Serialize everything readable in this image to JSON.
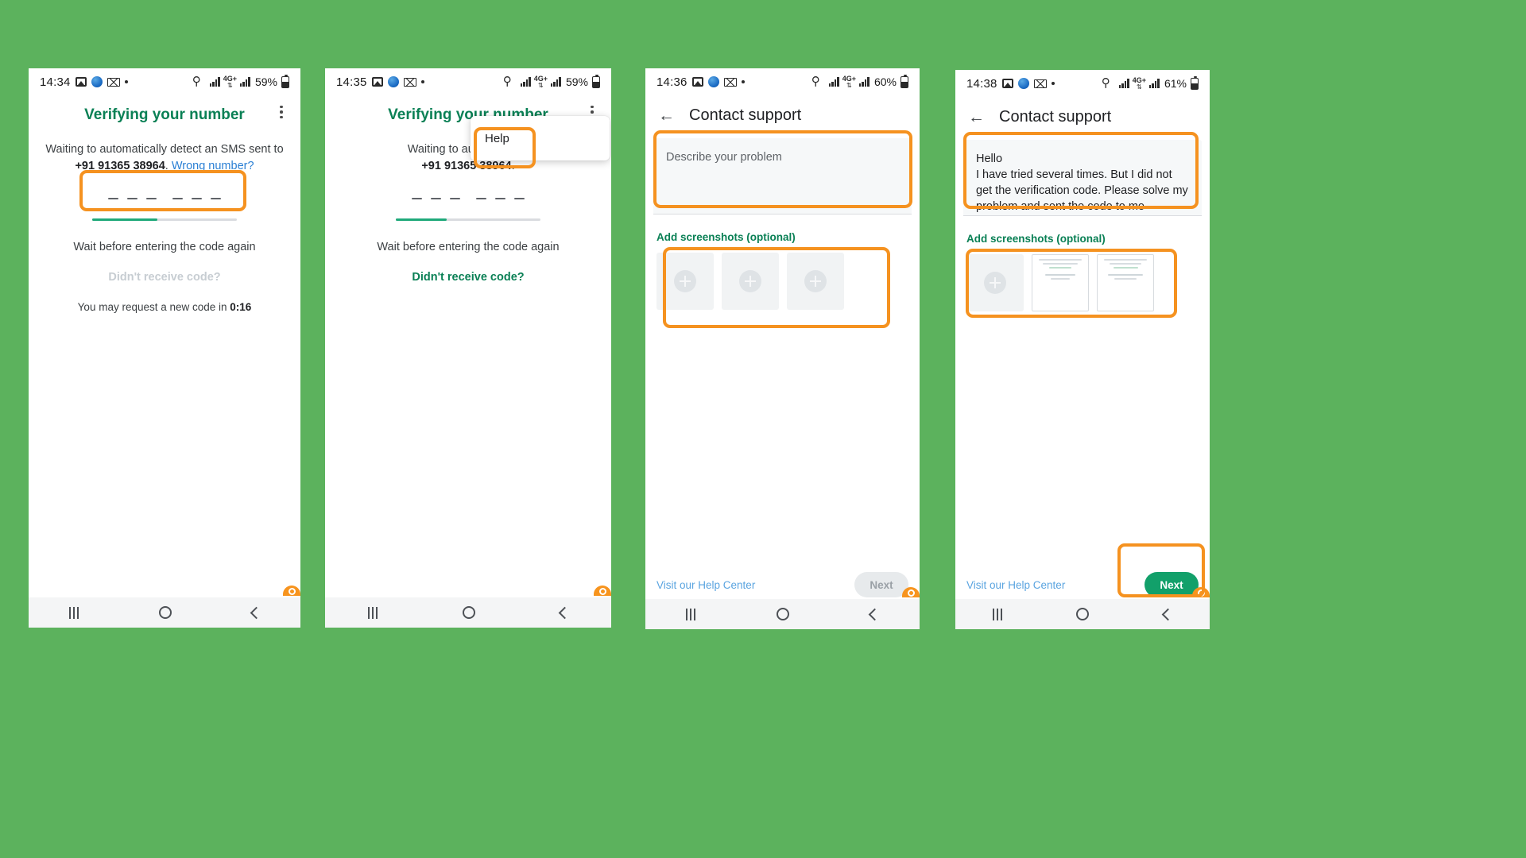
{
  "page": {
    "background_color": "#5cb25d",
    "annotation_color": "#f59220",
    "brand_green": "#0a8055",
    "link_blue": "#2a7fd4"
  },
  "panels": [
    {
      "id": "panel-1-verify-waiting",
      "status": {
        "time": "14:34",
        "battery": "59%",
        "icons": [
          "photos-icon",
          "profile-icon",
          "gmail-icon",
          "dot-icon",
          "key-icon",
          "signal-icon",
          "network-4g-icon",
          "signal-icon",
          "battery-icon"
        ],
        "network_label": "4G+"
      },
      "title": "Verifying your number",
      "menu_icon": "kebab-menu-icon",
      "body_line_1": "Waiting to automatically detect an SMS sent to",
      "phone_number": "+91 91365 38964",
      "after_number": ".",
      "wrong_number_link": "Wrong number?",
      "code_progress_percent": 45,
      "wait_text": "Wait before entering the code again",
      "didnt_receive": "Didn't receive code?",
      "didnt_receive_state": "disabled",
      "timer_prefix": "You may request a new code in ",
      "timer_value": "0:16",
      "help_menu_visible": false,
      "navbar": [
        "recents-icon",
        "home-icon",
        "back-icon"
      ]
    },
    {
      "id": "panel-2-verify-help-menu",
      "status": {
        "time": "14:35",
        "battery": "59%",
        "icons": [
          "photos-icon",
          "profile-icon",
          "gmail-icon",
          "dot-icon",
          "key-icon",
          "signal-icon",
          "network-4g-icon",
          "signal-icon",
          "battery-icon"
        ],
        "network_label": "4G+"
      },
      "title": "Verifying your number",
      "menu_icon": "kebab-menu-icon",
      "body_line_1": "Waiting to automatically",
      "phone_number": "+91 91365 38964",
      "after_number": ".",
      "wrong_number_link": "",
      "code_progress_percent": 35,
      "wait_text": "Wait before entering the code again",
      "didnt_receive": "Didn't receive code?",
      "didnt_receive_state": "active",
      "timer_prefix": "",
      "timer_value": "",
      "help_menu_visible": true,
      "help_menu_item": "Help",
      "navbar": [
        "recents-icon",
        "home-icon",
        "back-icon"
      ]
    },
    {
      "id": "panel-3-contact-support-empty",
      "status": {
        "time": "14:36",
        "battery": "60%",
        "icons": [
          "photos-icon",
          "profile-icon",
          "gmail-icon",
          "dot-icon",
          "key-icon",
          "signal-icon",
          "network-4g-icon",
          "signal-icon",
          "battery-icon"
        ],
        "network_label": "4G+"
      },
      "back_icon": "back-arrow-icon",
      "title": "Contact support",
      "problem_placeholder": "Describe your problem",
      "problem_value": "",
      "add_screenshots_label": "Add screenshots (optional)",
      "screenshot_slots": [
        "add-slot",
        "add-slot",
        "add-slot"
      ],
      "help_center_link": "Visit our Help Center",
      "next_label": "Next",
      "next_enabled": false,
      "navbar": [
        "recents-icon",
        "home-icon",
        "back-icon"
      ]
    },
    {
      "id": "panel-4-contact-support-filled",
      "status": {
        "time": "14:38",
        "battery": "61%",
        "icons": [
          "photos-icon",
          "profile-icon",
          "gmail-icon",
          "dot-icon",
          "key-icon",
          "signal-icon",
          "network-4g-icon",
          "signal-icon",
          "battery-icon"
        ],
        "network_label": "4G+"
      },
      "back_icon": "back-arrow-icon",
      "title": "Contact support",
      "problem_placeholder": "Describe your problem",
      "problem_value": "Hello\nI have tried several times. But I did not get the verification code. Please solve my problem and sent the code to me",
      "add_screenshots_label": "Add screenshots (optional)",
      "screenshot_slots": [
        "add-slot",
        "screenshot-thumb",
        "screenshot-thumb"
      ],
      "help_center_link": "Visit our Help Center",
      "next_label": "Next",
      "next_enabled": true,
      "navbar": [
        "recents-icon",
        "home-icon",
        "back-icon"
      ]
    }
  ],
  "annotations": [
    {
      "name": "code-entry-highlight",
      "panel": 1
    },
    {
      "name": "help-menu-highlight",
      "panel": 2
    },
    {
      "name": "problem-field-highlight",
      "panel": 3
    },
    {
      "name": "screenshots-area-highlight",
      "panel": 3
    },
    {
      "name": "problem-text-highlight",
      "panel": 4
    },
    {
      "name": "screenshots-thumbs-highlight",
      "panel": 4
    },
    {
      "name": "next-button-highlight",
      "panel": 4
    }
  ]
}
